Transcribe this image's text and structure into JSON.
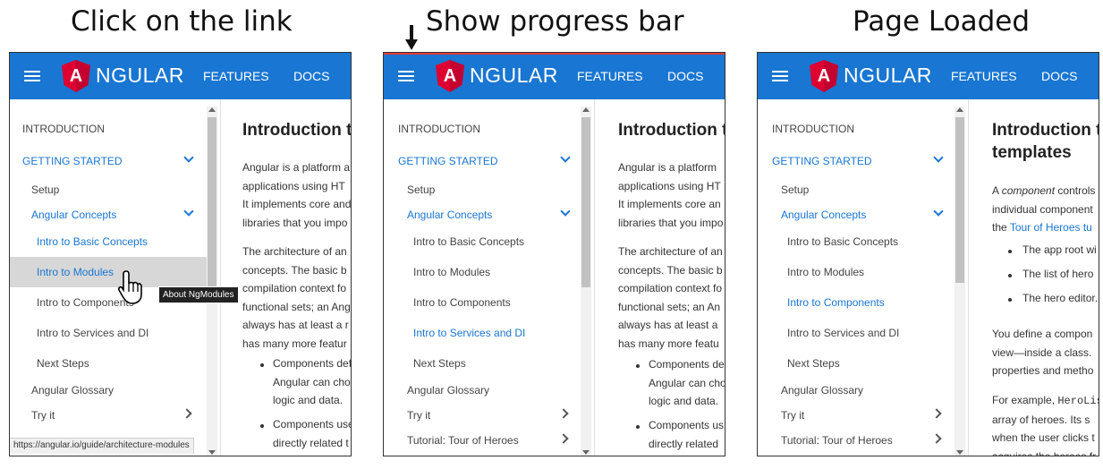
{
  "captions": [
    "Click on the link",
    "Show progress bar",
    "Page Loaded"
  ],
  "colors": {
    "accent": "#1976d2",
    "progress": "#e53935"
  },
  "header": {
    "logo_letter": "A",
    "logo_word": "NGULAR",
    "nav_features": "FEATURES",
    "nav_docs": "DOCS"
  },
  "sidebar": {
    "introduction": "INTRODUCTION",
    "getting_started": "GETTING STARTED",
    "setup": "Setup",
    "angular_concepts": "Angular Concepts",
    "intro_basic": "Intro to Basic Concepts",
    "intro_modules": "Intro to Modules",
    "intro_components": "Intro to Components",
    "intro_services": "Intro to Services and DI",
    "next_steps": "Next Steps",
    "glossary": "Angular Glossary",
    "try_it": "Try it",
    "tutorial": "Tutorial: Tour of Heroes"
  },
  "panel1": {
    "title": "Introduction t",
    "p1": [
      "Angular is a platform a",
      "applications using HT",
      "It implements core and",
      "libraries that you impo"
    ],
    "p2": [
      "The architecture of an",
      "concepts. The basic b",
      "compilation context fo",
      "functional sets; an Ang",
      "always has at least a r",
      "has many more featur"
    ],
    "b1": [
      "Components def",
      "Angular can cho",
      "logic and data."
    ],
    "b2": [
      "Components use",
      "directly related t"
    ],
    "tooltip": "About NgModules",
    "status_url": "https://angular.io/guide/architecture-modules"
  },
  "panel2": {
    "title": "Introduction t",
    "p1": [
      "Angular is a platform",
      "applications using HT",
      "It implements core an",
      "libraries that you impo"
    ],
    "p2": [
      "The architecture of an",
      "concepts. The basic b",
      "compilation context fo",
      "functional sets; an An",
      "always has at least a",
      "has many more featu"
    ],
    "b1": [
      "Components de",
      "Angular can cho",
      "logic and data."
    ],
    "b2": [
      "Components us",
      "directly related"
    ]
  },
  "panel3": {
    "title1": "Introduction t",
    "title2": "templates",
    "p1_pre": "A ",
    "p1_em": "component",
    "p1_post": " controls",
    "p1_l2": "individual component",
    "p1_l3_pre": "the ",
    "p1_l3_link": "Tour of Heroes tu",
    "bullets": [
      "The app root wi",
      "The list of hero",
      "The hero editor."
    ],
    "p2": [
      "You define a compon",
      "view—inside a class.",
      "properties and metho"
    ],
    "p3_pre": "For example, ",
    "p3_code": "HeroLis",
    "p3": [
      "array of heroes. Its s",
      "when the user clicks t",
      "acquires the heroes fr"
    ]
  }
}
